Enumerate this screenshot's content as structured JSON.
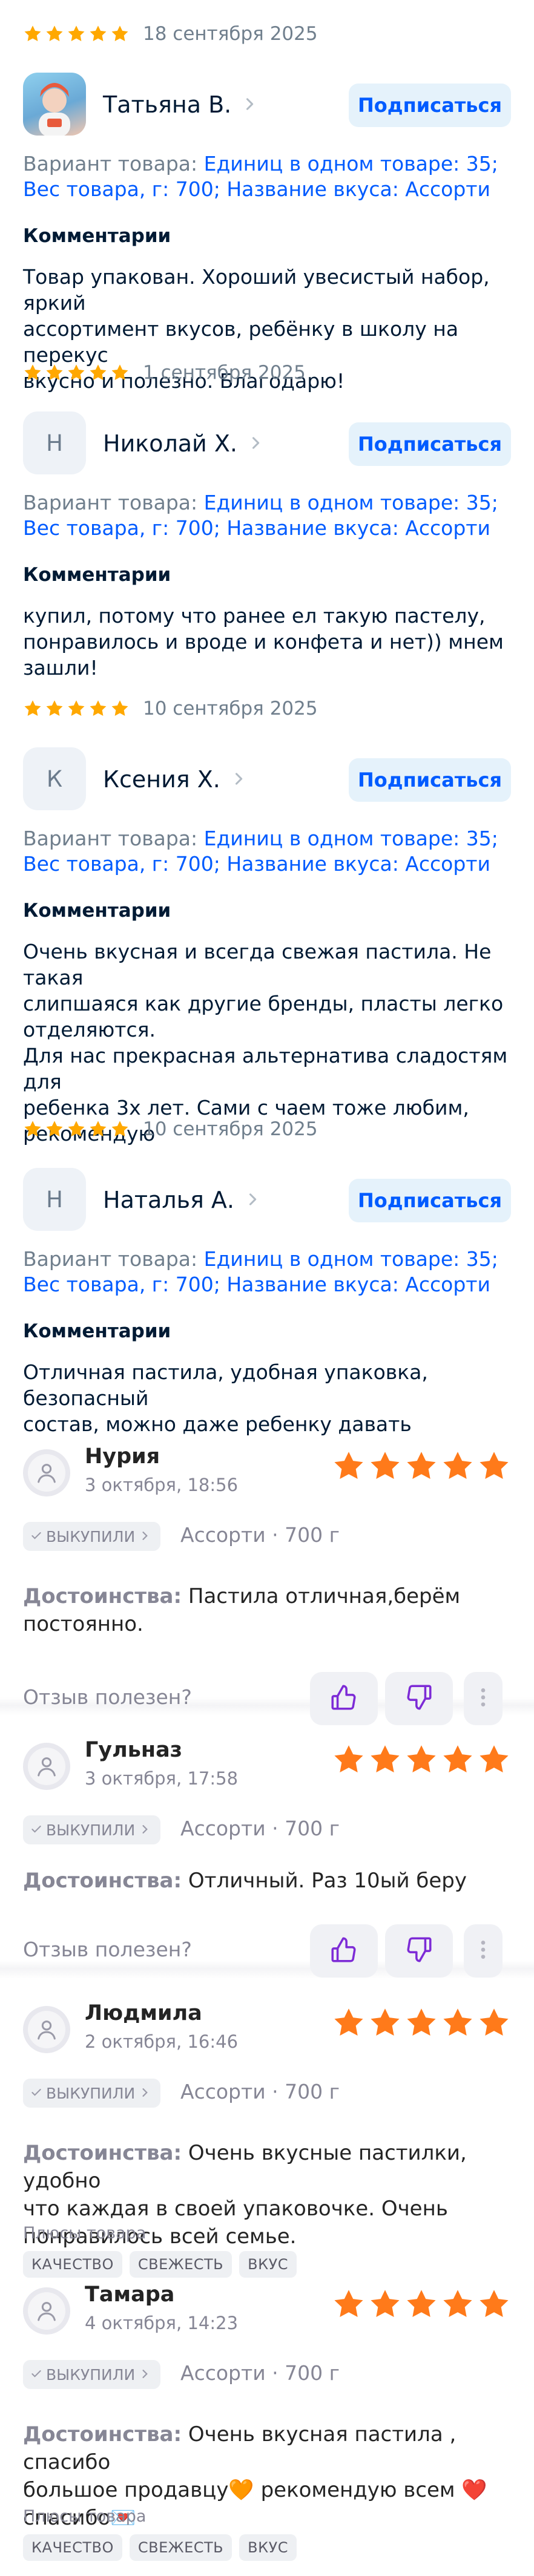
{
  "ozon_reviews": [
    {
      "date": "18 сентября 2025",
      "avatar_letter": "",
      "has_photo": true,
      "name": "Татьяна В.",
      "subscribe": "Подписаться",
      "variant_label": "Вариант товара: ",
      "variant_value": "Единиц в одном товаре: 35; Вес товара, г: 700; Название вкуса: Ассорти",
      "comment_heading": "Комментарии",
      "comment_lines": [
        "Товар упакован. Хороший увесистый набор, яркий",
        "ассортимент вкусов, ребёнку в школу на перекус",
        "вкусно и полезно. Благодарю!"
      ]
    },
    {
      "date": "1 сентября 2025",
      "avatar_letter": "Н",
      "has_photo": false,
      "name": "Николай Х.",
      "subscribe": "Подписаться",
      "variant_label": "Вариант товара: ",
      "variant_value": "Единиц в одном товаре: 35; Вес товара, г: 700; Название вкуса: Ассорти",
      "comment_heading": "Комментарии",
      "comment_lines": [
        "купил, потому что ранее ел такую пастелу,",
        "понравилось и вроде и конфета и нет)) мнем",
        "зашли!"
      ]
    },
    {
      "date": "10 сентября 2025",
      "avatar_letter": "К",
      "has_photo": false,
      "name": "Ксения Х.",
      "subscribe": "Подписаться",
      "variant_label": "Вариант товара: ",
      "variant_value": "Единиц в одном товаре: 35; Вес товара, г: 700; Название вкуса: Ассорти",
      "comment_heading": "Комментарии",
      "comment_lines": [
        "Очень вкусная и всегда свежая пастила. Не такая",
        "слипшаяся как другие бренды, пласты легко",
        "отделяются.",
        "Для нас прекрасная альтернатива сладостям для",
        "ребенка 3х лет. Сами с чаем тоже любим,",
        "рекомендую"
      ]
    },
    {
      "date": "10 сентября 2025",
      "avatar_letter": "Н",
      "has_photo": false,
      "name": "Наталья А.",
      "subscribe": "Подписаться",
      "variant_label": "Вариант товара: ",
      "variant_value": "Единиц в одном товаре: 35; Вес товара, г: 700; Название вкуса: Ассорти",
      "comment_heading": "Комментарии",
      "comment_lines": [
        "Отличная пастила, удобная упаковка, безопасный",
        "состав, можно даже ребенку давать"
      ]
    }
  ],
  "wb_reviews": [
    {
      "name": "Нурия",
      "date": "3 октября, 18:56",
      "bought": "ВЫКУПИЛИ",
      "option": "Ассорти · 700 г",
      "pros_label": "Достоинства:",
      "pros_lines": [
        "Пастила отличная,берём",
        "постоянно."
      ],
      "useful": "Отзыв полезен?",
      "plus_label": "",
      "tags": []
    },
    {
      "name": "Гульназ",
      "date": "3 октября, 17:58",
      "bought": "ВЫКУПИЛИ",
      "option": "Ассорти · 700 г",
      "pros_label": "Достоинства:",
      "pros_lines": [
        "Отличный. Раз 10ый беру"
      ],
      "useful": "Отзыв полезен?",
      "plus_label": "",
      "tags": []
    },
    {
      "name": "Людмила",
      "date": "2 октября, 16:46",
      "bought": "ВЫКУПИЛИ",
      "option": "Ассорти · 700 г",
      "pros_label": "Достоинства:",
      "pros_lines": [
        "Очень вкусные пастилки, удобно",
        "что каждая в своей упаковочке. Очень",
        "понравилось всей семье."
      ],
      "useful": "",
      "plus_label": "Плюсы товара",
      "tags": [
        "КАЧЕСТВО",
        "СВЕЖЕСТЬ",
        "ВКУС"
      ]
    },
    {
      "name": "Тамара",
      "date": "4 октября, 14:23",
      "bought": "ВЫКУПИЛИ",
      "option": "Ассорти · 700 г",
      "pros_label": "Достоинства:",
      "pros_lines": [
        "Очень вкусная пастила , спасибо",
        "большое продавцу🧡 рекомендую всем ❤️",
        "спасибо💌"
      ],
      "useful": "",
      "plus_label": "Плюсы товара",
      "tags": [
        "КАЧЕСТВО",
        "СВЕЖЕСТЬ",
        "ВКУС"
      ]
    }
  ],
  "colors": {
    "ozon_star": "#ffa800",
    "wb_star": "#ff7a1a",
    "link": "#005bff",
    "wb_like": "#7d2bd6"
  },
  "icons": [
    "star-icon",
    "chevron-right-icon",
    "user-icon",
    "check-icon",
    "thumb-up-icon",
    "thumb-down-icon",
    "more-vert-icon"
  ]
}
